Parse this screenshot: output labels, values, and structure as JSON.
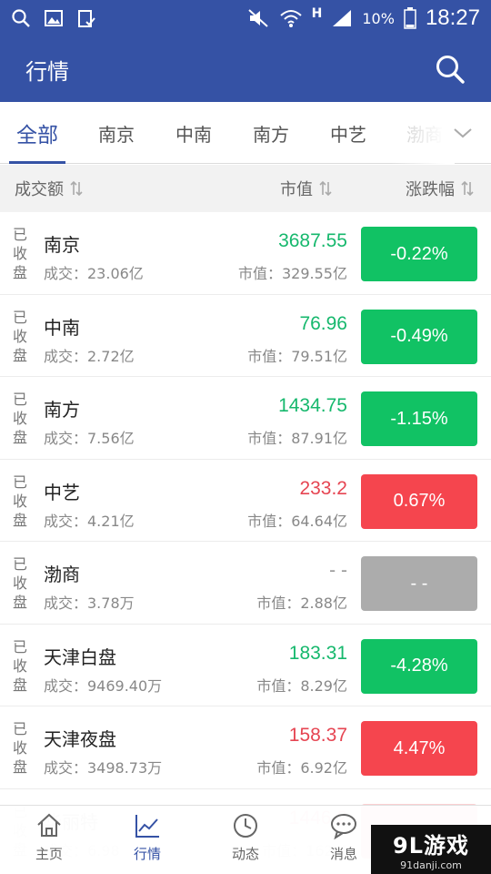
{
  "statusbar": {
    "network_type": "H",
    "battery": "10%",
    "time": "18:27"
  },
  "header": {
    "title": "行情"
  },
  "tabs": [
    {
      "label": "全部",
      "active": true
    },
    {
      "label": "南京",
      "active": false
    },
    {
      "label": "中南",
      "active": false
    },
    {
      "label": "南方",
      "active": false
    },
    {
      "label": "中艺",
      "active": false
    },
    {
      "label": "渤商",
      "active": false
    }
  ],
  "sort_header": {
    "volume": "成交额",
    "market_cap": "市值",
    "change": "涨跌幅"
  },
  "rows": [
    {
      "status": "已收盘",
      "name": "南京",
      "volume": "成交：23.06亿",
      "price": "3687.55",
      "market_cap": "市值：329.55亿",
      "change": "-0.22%",
      "trend": "down"
    },
    {
      "status": "已收盘",
      "name": "中南",
      "volume": "成交：2.72亿",
      "price": "76.96",
      "market_cap": "市值：79.51亿",
      "change": "-0.49%",
      "trend": "down"
    },
    {
      "status": "已收盘",
      "name": "南方",
      "volume": "成交：7.56亿",
      "price": "1434.75",
      "market_cap": "市值：87.91亿",
      "change": "-1.15%",
      "trend": "down"
    },
    {
      "status": "已收盘",
      "name": "中艺",
      "volume": "成交：4.21亿",
      "price": "233.2",
      "market_cap": "市值：64.64亿",
      "change": "0.67%",
      "trend": "up"
    },
    {
      "status": "已收盘",
      "name": "渤商",
      "volume": "成交：3.78万",
      "price": "- -",
      "market_cap": "市值：2.88亿",
      "change": "- -",
      "trend": "flat"
    },
    {
      "status": "已收盘",
      "name": "天津白盘",
      "volume": "成交：9469.40万",
      "price": "183.31",
      "market_cap": "市值：8.29亿",
      "change": "-4.28%",
      "trend": "down"
    },
    {
      "status": "已收盘",
      "name": "天津夜盘",
      "volume": "成交：3498.73万",
      "price": "158.37",
      "market_cap": "市值：6.92亿",
      "change": "4.47%",
      "trend": "up"
    },
    {
      "status": "已收盘",
      "name": "华丽特",
      "volume": "成交：6.98",
      "price": "1446.2",
      "market_cap": "市值：162.4",
      "change": "",
      "trend": "up",
      "partial": true
    }
  ],
  "bottom_nav": [
    {
      "label": "主页",
      "icon": "home-icon",
      "active": false
    },
    {
      "label": "行情",
      "icon": "chart-icon",
      "active": true
    },
    {
      "label": "动态",
      "icon": "clock-icon",
      "active": false
    },
    {
      "label": "消息",
      "icon": "message-icon",
      "active": false
    }
  ],
  "watermark": {
    "main": "9L游戏",
    "sub": "91danji.com"
  },
  "colors": {
    "brand": "#3552a5",
    "up": "#f5454e",
    "down": "#11c264",
    "flat": "#acacac"
  }
}
